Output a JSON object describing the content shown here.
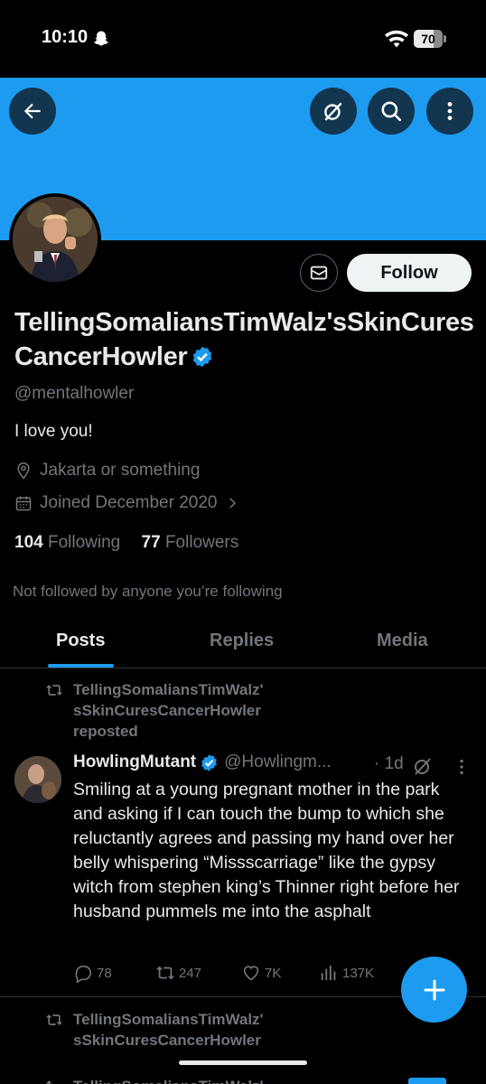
{
  "status_bar": {
    "time": "10:10",
    "battery": "70",
    "battery_level": 0.7
  },
  "header": {
    "back_icon": "arrow-left-icon",
    "grok_icon": "grok-icon",
    "search_icon": "search-icon",
    "more_icon": "more-vertical-icon"
  },
  "colors": {
    "banner": "#1d9bf0",
    "accent": "#1d9bf0",
    "follow_bg": "#eff3f4"
  },
  "profile": {
    "display_name": "TellingSomaliansTimWalz'sSkinCuresCancerHowler",
    "handle": "@mentalhowler",
    "bio": "I love you!",
    "location": "Jakarta or something",
    "joined": "Joined December 2020",
    "following_count": "104",
    "following_label": "Following",
    "followers_count": "77",
    "followers_label": "Followers",
    "not_followed": "Not followed by anyone you’re following",
    "follow_label": "Follow"
  },
  "tabs": [
    {
      "label": "Posts",
      "active": true
    },
    {
      "label": "Replies",
      "active": false
    },
    {
      "label": "Media",
      "active": false
    }
  ],
  "posts": [
    {
      "repost_line1": "TellingSomaliansTimWalz'",
      "repost_line2": "sSkinCuresCancerHowler",
      "repost_line3": "reposted",
      "author": "HowlingMutant",
      "handle": "@Howlingm...",
      "time": "· 1d",
      "text": "Smiling at a young pregnant mother in the park and asking if I can touch the bump to which she reluctantly agrees and passing my hand over her belly whispering “Missscarriage” like the gypsy witch from stephen king’s Thinner right before her husband pummels me into the asphalt",
      "replies": "78",
      "reposts": "247",
      "likes": "7K",
      "views": "137K"
    },
    {
      "repost_line1": "TellingSomaliansTimWalz'",
      "repost_line2": "sSkinCuresCancerHowler"
    }
  ],
  "next_repost_line1": "TellingSomaliansTimWalz'"
}
